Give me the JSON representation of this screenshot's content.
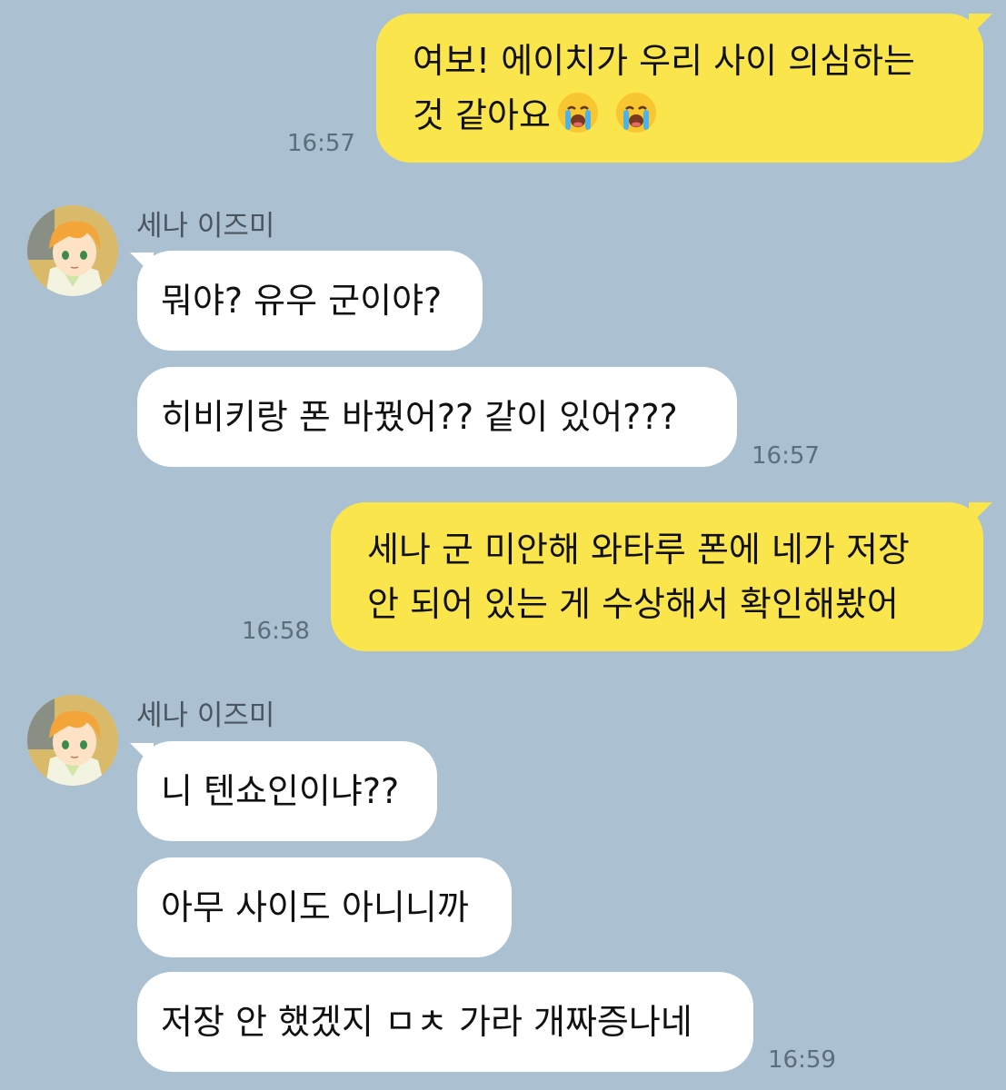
{
  "messages": [
    {
      "side": "me",
      "line1": "여보! 에이치가 우리 사이 의심하는",
      "line2": "것 같아요",
      "emojis": [
        "loudly-crying-face-icon",
        "loudly-crying-face-icon"
      ],
      "time": "16:57"
    },
    {
      "side": "them",
      "sender": "세나 이즈미",
      "texts": [
        "뭐야? 유우 군이야?",
        "히비키랑 폰 바꿨어?? 같이 있어???"
      ],
      "time": "16:57"
    },
    {
      "side": "me",
      "line1": "세나 군 미안해 와타루 폰에 네가 저장",
      "line2": "안 되어 있는 게 수상해서 확인해봤어",
      "time": "16:58"
    },
    {
      "side": "them",
      "sender": "세나 이즈미",
      "texts": [
        "니 텐쇼인이냐??",
        "아무 사이도 아니니까",
        "저장 안 했겠지 ㅁㅊ 가라 개짜증나네"
      ],
      "time": "16:59"
    }
  ],
  "colors": {
    "background": "#abc1d1",
    "my_bubble": "#fae54d",
    "their_bubble": "#ffffff",
    "time_text": "#5d6e7b"
  }
}
